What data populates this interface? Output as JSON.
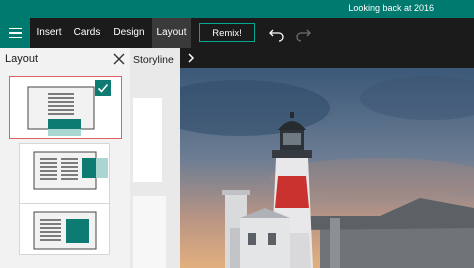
{
  "titlebar": {
    "title": "Looking back at 2016"
  },
  "toolbar": {
    "menu_icon": "hamburger-icon",
    "tabs": [
      {
        "label": "Insert"
      },
      {
        "label": "Cards"
      },
      {
        "label": "Design"
      },
      {
        "label": "Layout",
        "active": true
      }
    ],
    "remix_label": "Remix!",
    "undo_icon": "undo-icon",
    "redo_icon": "redo-icon"
  },
  "layout_panel": {
    "title": "Layout",
    "close_icon": "close-icon",
    "options": [
      {
        "name": "text-over-image",
        "selected": true
      },
      {
        "name": "text-beside-image-right"
      },
      {
        "name": "text-beside-image-left"
      }
    ],
    "check_icon": "checkmark-icon"
  },
  "storyline": {
    "label": "Storyline"
  },
  "canvas": {
    "expand_icon": "chevron-right-icon",
    "image": "lighthouse-photo"
  },
  "colors": {
    "accent": "#007a6f",
    "toolbar": "#1b1b1b",
    "remix_border": "#00a88f",
    "selection": "#e06060",
    "thumb_teal": "#0e7b73",
    "thumb_light": "#a9d6d1"
  }
}
